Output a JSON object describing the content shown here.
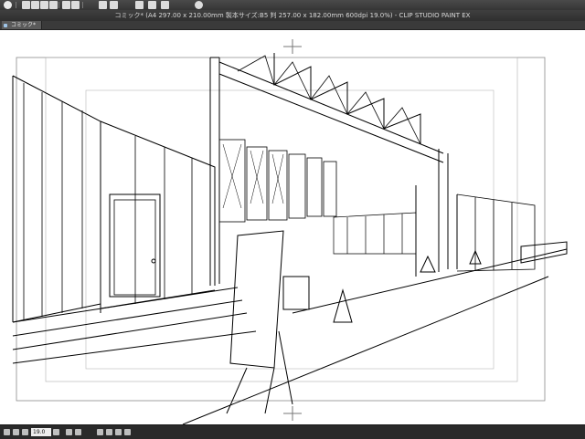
{
  "window": {
    "title": "コミック* (A4 297.00 x 210.00mm 製本サイズ:B5 判 257.00 x 182.00mm 600dpi 19.0%) - CLIP STUDIO PAINT EX"
  },
  "toolbar": {
    "icons": [
      "eye-icon",
      "new-icon",
      "open-icon",
      "save-icon",
      "close-icon",
      "undo-icon",
      "redo-icon",
      "clear-icon",
      "fill-icon",
      "select-icon",
      "pen-icon",
      "brush-icon",
      "help-icon"
    ]
  },
  "tab": {
    "label": "コミック*"
  },
  "status": {
    "zoom": "19.0"
  },
  "colors": {
    "ui_dark": "#2b2b2b",
    "paper": "#ffffff",
    "guide": "#9c9c9c"
  }
}
